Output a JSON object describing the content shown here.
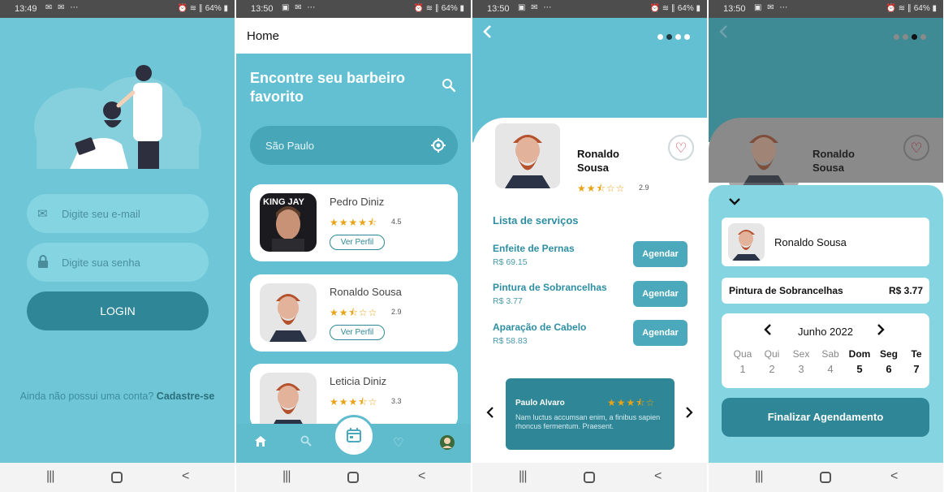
{
  "screens": [
    {
      "status": {
        "time": "13:49",
        "icons": "✉ ✉ ⋯",
        "right": "⏰ ≋ ∥ 64% ▮"
      },
      "email_placeholder": "Digite seu e-mail",
      "password_placeholder": "Digite sua senha",
      "login_label": "LOGIN",
      "signup_prompt": "Ainda não possui uma conta? ",
      "signup_link": "Cadastre-se"
    },
    {
      "status": {
        "time": "13:50",
        "icons": "▣ ✉ ⋯",
        "right": "⏰ ≋ ∥ 64% ▮"
      },
      "title": "Home",
      "hero": "Encontre seu barbeiro favorito",
      "location": "São Paulo",
      "barbers": [
        {
          "name": "Pedro Diniz",
          "stars": "★★★★⯪",
          "rating": "4.5",
          "button": "Ver Perfil"
        },
        {
          "name": "Ronaldo Sousa",
          "stars": "★★⯪☆☆",
          "rating": "2.9",
          "button": "Ver Perfil"
        },
        {
          "name": "Leticia Diniz",
          "stars": "★★★⯪☆",
          "rating": "3.3",
          "button": ""
        }
      ]
    },
    {
      "status": {
        "time": "13:50",
        "icons": "▣ ✉ ⋯",
        "right": "⏰ ≋ ∥ 64% ▮"
      },
      "barber_first": "Ronaldo",
      "barber_last": "Sousa",
      "stars": "★★⯪☆☆",
      "rating": "2.9",
      "services_title": "Lista de serviços",
      "services": [
        {
          "name": "Enfeite de Pernas",
          "price": "R$ 69.15",
          "button": "Agendar"
        },
        {
          "name": "Pintura de Sobrancelhas",
          "price": "R$ 3.77",
          "button": "Agendar"
        },
        {
          "name": "Aparação de Cabelo",
          "price": "R$ 58.83",
          "button": "Agendar"
        }
      ],
      "review": {
        "author": "Paulo Alvaro",
        "stars": "★★★⯪☆",
        "text": "Nam luctus accumsan enim, a finibus sapien rhoncus fermentum. Praesent."
      }
    },
    {
      "status": {
        "time": "13:50",
        "icons": "▣ ✉ ⋯",
        "right": "⏰ ≋ ∥ 64% ▮"
      },
      "barber_first": "Ronaldo",
      "barber_last": "Sousa",
      "selected_barber": "Ronaldo Sousa",
      "service_name": "Pintura de Sobrancelhas",
      "service_price": "R$ 3.77",
      "month": "Junho 2022",
      "days": [
        {
          "name": "Qua",
          "num": "1"
        },
        {
          "name": "Qui",
          "num": "2"
        },
        {
          "name": "Sex",
          "num": "3"
        },
        {
          "name": "Sab",
          "num": "4"
        },
        {
          "name": "Dom",
          "num": "5"
        },
        {
          "name": "Seg",
          "num": "6"
        },
        {
          "name": "Te",
          "num": "7"
        }
      ],
      "finalize_label": "Finalizar Agendamento"
    }
  ],
  "colors": {
    "teal_light": "#6ec6d6",
    "teal": "#62c0d2",
    "teal_dark": "#2e8696",
    "star": "#e8a317",
    "heart": "#d23a4a"
  },
  "icons": [
    "mail-icon",
    "lock-icon",
    "search-icon",
    "location-target-icon",
    "home-icon",
    "calendar-icon",
    "heart-icon",
    "back-arrow-icon",
    "chevron-down-icon"
  ]
}
